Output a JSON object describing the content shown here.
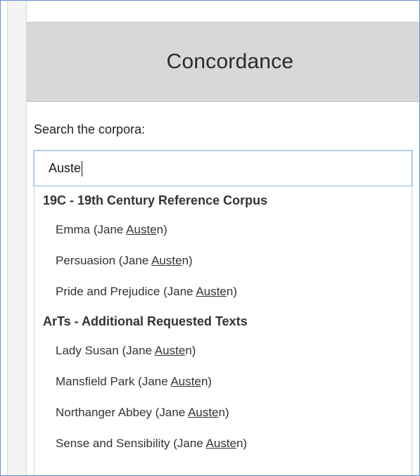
{
  "panel": {
    "title": "Concordance"
  },
  "search": {
    "label": "Search the corpora:",
    "value": "Auste"
  },
  "dropdown": {
    "groups": [
      {
        "header": "19C - 19th Century Reference Corpus",
        "items": [
          {
            "before": "Emma (Jane ",
            "match": "Auste",
            "after": "n)"
          },
          {
            "before": "Persuasion (Jane ",
            "match": "Auste",
            "after": "n)"
          },
          {
            "before": "Pride and Prejudice (Jane ",
            "match": "Auste",
            "after": "n)"
          }
        ]
      },
      {
        "header": "ArTs - Additional Requested Texts",
        "items": [
          {
            "before": "Lady Susan (Jane ",
            "match": "Auste",
            "after": "n)"
          },
          {
            "before": "Mansfield Park (Jane ",
            "match": "Auste",
            "after": "n)"
          },
          {
            "before": "Northanger Abbey (Jane ",
            "match": "Auste",
            "after": "n)"
          },
          {
            "before": "Sense and Sensibility (Jane ",
            "match": "Auste",
            "after": "n)"
          }
        ]
      }
    ]
  }
}
